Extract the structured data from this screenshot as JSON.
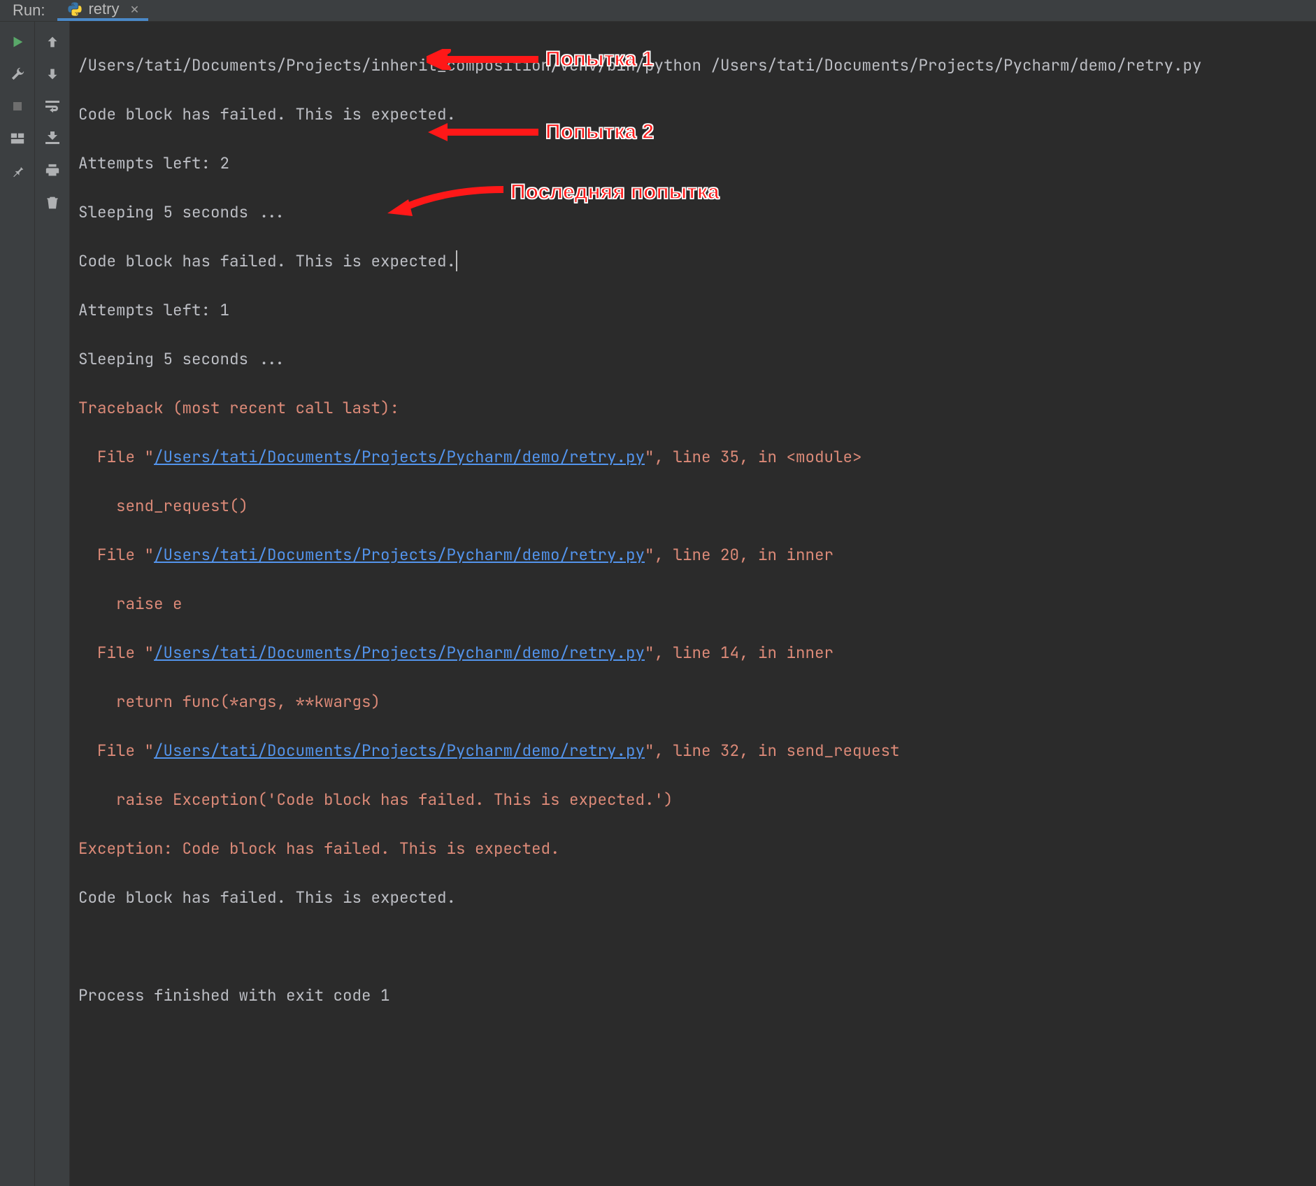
{
  "header": {
    "title": "Run:",
    "tab_label": "retry"
  },
  "console": {
    "cmd": "/Users/tati/Documents/Projects/inherit_composition/venv/bin/python /Users/tati/Documents/Projects/Pycharm/demo/retry.py",
    "fail_msg": "Code block has failed. This is expected.",
    "attempts2": "Attempts left: 2",
    "sleep": "Sleeping 5 seconds ...",
    "attempts1": "Attempts left: 1",
    "traceback_header": "Traceback (most recent call last):",
    "tb": [
      {
        "prefix": "  File \"",
        "link": "/Users/tati/Documents/Projects/Pycharm/demo/retry.py",
        "suffix": "\", line 35, in <module>"
      },
      {
        "code": "    send_request()"
      },
      {
        "prefix": "  File \"",
        "link": "/Users/tati/Documents/Projects/Pycharm/demo/retry.py",
        "suffix": "\", line 20, in inner"
      },
      {
        "code": "    raise e"
      },
      {
        "prefix": "  File \"",
        "link": "/Users/tati/Documents/Projects/Pycharm/demo/retry.py",
        "suffix": "\", line 14, in inner"
      },
      {
        "code": "    return func(*args, **kwargs)"
      },
      {
        "prefix": "  File \"",
        "link": "/Users/tati/Documents/Projects/Pycharm/demo/retry.py",
        "suffix": "\", line 32, in send_request"
      },
      {
        "code": "    raise Exception('Code block has failed. This is expected.')"
      }
    ],
    "exception_line": "Exception: Code block has failed. This is expected.",
    "final_fail": "Code block has failed. This is expected.",
    "exit": "Process finished with exit code 1"
  },
  "annotations": {
    "attempt1": "Попытка 1",
    "attempt2": "Попытка 2",
    "last_attempt": "Последняя попытка"
  },
  "colors": {
    "accent": "#4a88c7",
    "error": "#dc8a78",
    "link": "#5394ec",
    "annotation": "#ff1818"
  }
}
